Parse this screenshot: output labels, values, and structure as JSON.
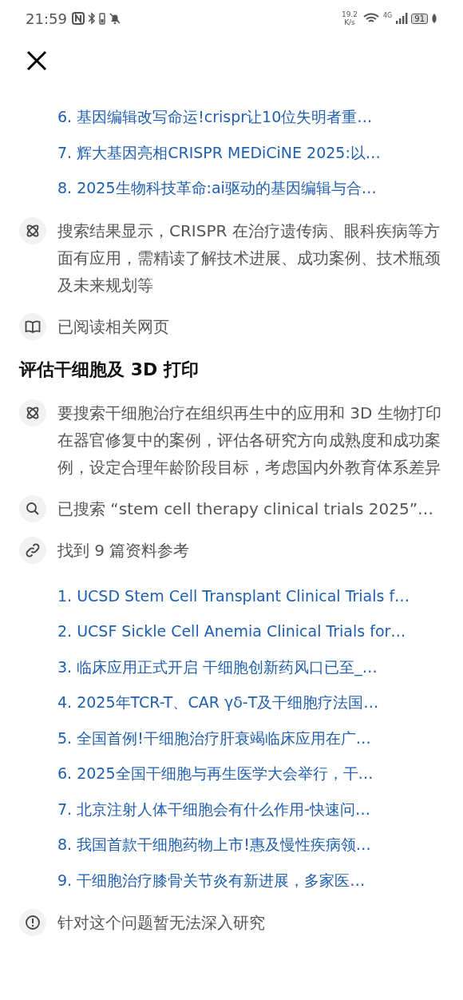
{
  "status_bar": {
    "time": "21:59",
    "speed_value": "19.2",
    "speed_unit": "K/s",
    "network": "4G",
    "battery": "91"
  },
  "blocks": [
    {
      "kind": "links",
      "items": [
        "6. 基因编辑改写命运!crispr让10位失明者重…",
        "7. 辉大基因亮相CRISPR MEDiCiNE 2025:以…",
        "8. 2025生物科技革命:ai驱动的基因编辑与合…"
      ]
    },
    {
      "kind": "thought",
      "text": "搜索结果显示，CRISPR 在治疗遗传病、眼科疾病等方面有应用，需精读了解技术进展、成功案例、技术瓶颈及未来规划等"
    },
    {
      "kind": "read",
      "text": "已阅读相关网页"
    },
    {
      "kind": "heading",
      "text": "评估干细胞及 3D 打印"
    },
    {
      "kind": "thought",
      "text": "要搜索干细胞治疗在组织再生中的应用和 3D 生物打印在器官修复中的案例，评估各研究方向成熟度和成功案例，设定合理年龄阶段目标，考虑国内外教育体系差异"
    },
    {
      "kind": "search",
      "text": "已搜索 “stem cell therapy clinical trials 2025”…"
    },
    {
      "kind": "sources",
      "text": "找到 9 篇资料参考"
    },
    {
      "kind": "links",
      "items": [
        "1. UCSD Stem Cell Transplant Clinical Trials f…",
        "2. UCSF Sickle Cell Anemia Clinical Trials for…",
        "3. 临床应用正式开启 干细胞创新药风口已至_…",
        "4. 2025年TCR-T、CAR γδ-T及干细胞疗法国…",
        "5. 全国首例!干细胞治疗肝衰竭临床应用在广…",
        "6. 2025全国干细胞与再生医学大会举行，干…",
        "7. 北京注射人体干细胞会有什么作用-快速问…",
        "8. 我国首款干细胞药物上市!惠及慢性疾病领…",
        "9. 干细胞治疗膝骨关节炎有新进展，多家医…"
      ]
    },
    {
      "kind": "notice",
      "text": "针对这个问题暂无法深入研究"
    }
  ]
}
